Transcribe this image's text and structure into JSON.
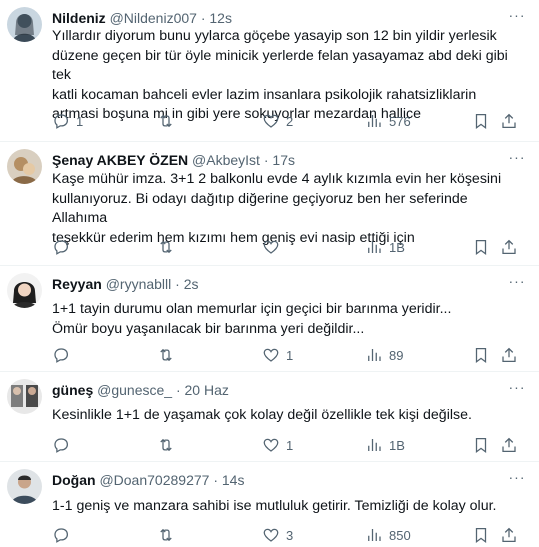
{
  "tweets": [
    {
      "name": "Nildeniz",
      "handle": "@Nildeniz007",
      "dot": "·",
      "time": "12s",
      "text": "Yıllardır diyorum bunu yylarca göçebe yasayip son 12 bin yildir yerlesik\ndüzene geçen bir tür öyle minicik yerlerde felan yasayamaz abd deki gibi tek\nkatli kocaman bahceli evler lazim insanlara psikolojik rahatsizliklarin\nartmasi boşuna mi in gibi yere sokuyorlar mezardan hallice",
      "replies": "1",
      "retweets": "",
      "likes": "2",
      "views": "576"
    },
    {
      "name": "Şenay AKBEY ÖZEN",
      "handle": "@AkbeyIst",
      "dot": "·",
      "time": "17s",
      "text": "Kaşe mühür imza. 3+1 2 balkonlu evde 4 aylık kızımla evin her köşesini\nkullanıyoruz. Bi odayı dağıtıp diğerine geçiyoruz ben her seferinde Allahıma\nteşekkür ederim hem kızımı hem geniş evi nasip ettiği için",
      "replies": "",
      "retweets": "",
      "likes": "",
      "views": "1B"
    },
    {
      "name": "Reyyan",
      "handle": "@ryynablll",
      "dot": "·",
      "time": "2s",
      "text": "1+1 tayin durumu olan memurlar için geçici bir barınma yeridir...\nÖmür boyu yaşanılacak bir barınma yeri değildir...",
      "replies": "",
      "retweets": "",
      "likes": "1",
      "views": "89"
    },
    {
      "name": "güneş",
      "handle": "@gunesce_",
      "dot": "·",
      "time": "20 Haz",
      "text": "Kesinlikle 1+1 de yaşamak çok kolay değil özellikle tek kişi değilse.",
      "replies": "",
      "retweets": "",
      "likes": "1",
      "views": "1B"
    },
    {
      "name": "Doğan",
      "handle": "@Doan70289277",
      "dot": "·",
      "time": "14s",
      "text": "1-1 geniş ve manzara sahibi ise mutluluk getirir. Temizliği de kolay olur.",
      "replies": "",
      "retweets": "",
      "likes": "3",
      "views": "850"
    }
  ],
  "more_glyph": "···",
  "colors": {
    "text": "#0f1419",
    "secondary": "#536471",
    "divider": "#eff3f4",
    "background": "#ffffff"
  },
  "icons": [
    "reply-icon",
    "retweet-icon",
    "like-icon",
    "views-icon",
    "bookmark-icon",
    "share-icon",
    "more-icon"
  ]
}
